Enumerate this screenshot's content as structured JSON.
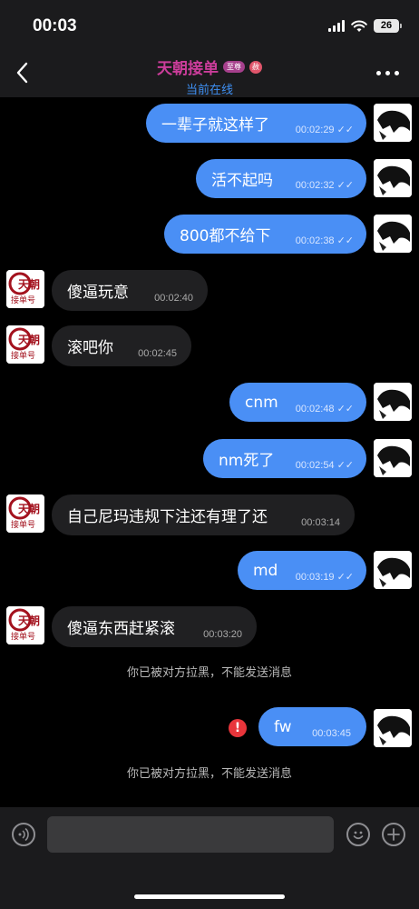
{
  "status_bar": {
    "time": "00:03",
    "battery": "26"
  },
  "header": {
    "title": "天朝接单",
    "badge_vip": "至尊",
    "badge_extra": "赦",
    "subtitle": "当前在线",
    "accent_title": "#cc3d9b",
    "accent_subtitle": "#3e8ff2"
  },
  "messages": [
    {
      "side": "out",
      "text": "一辈子就这样了",
      "time": "00:02:29",
      "read": true
    },
    {
      "side": "out",
      "text": "活不起吗",
      "time": "00:02:32",
      "read": true
    },
    {
      "side": "out",
      "text": "800都不给下",
      "time": "00:02:38",
      "read": true
    },
    {
      "side": "in",
      "text": "傻逼玩意",
      "time": "00:02:40"
    },
    {
      "side": "in",
      "text": "滚吧你",
      "time": "00:02:45"
    },
    {
      "side": "out",
      "text": "cnm",
      "time": "00:02:48",
      "read": true
    },
    {
      "side": "out",
      "text": "nm死了",
      "time": "00:02:54",
      "read": true
    },
    {
      "side": "in",
      "text": "自己尼玛违规下注还有理了还",
      "time": "00:03:14"
    },
    {
      "side": "out",
      "text": "md",
      "time": "00:03:19",
      "read": true
    },
    {
      "side": "in",
      "text": "傻逼东西赶紧滚",
      "time": "00:03:20"
    },
    {
      "side": "out",
      "text": "fw",
      "time": "00:03:45",
      "failed": true
    }
  ],
  "system_notices": [
    "你已被对方拉黑，不能发送消息",
    "你已被对方拉黑，不能发送消息"
  ],
  "avatar_other_text": [
    "天朝",
    "接单号"
  ],
  "input": {
    "placeholder": ""
  },
  "icons": {
    "back": "chevron-left-icon",
    "more": "more-dots-icon",
    "voice": "voice-icon",
    "emoji": "emoji-icon",
    "plus": "plus-icon",
    "error": "error-icon"
  },
  "colors": {
    "outgoing_bubble": "#4a8ff5",
    "incoming_bubble": "#202022",
    "error": "#e8353b"
  }
}
